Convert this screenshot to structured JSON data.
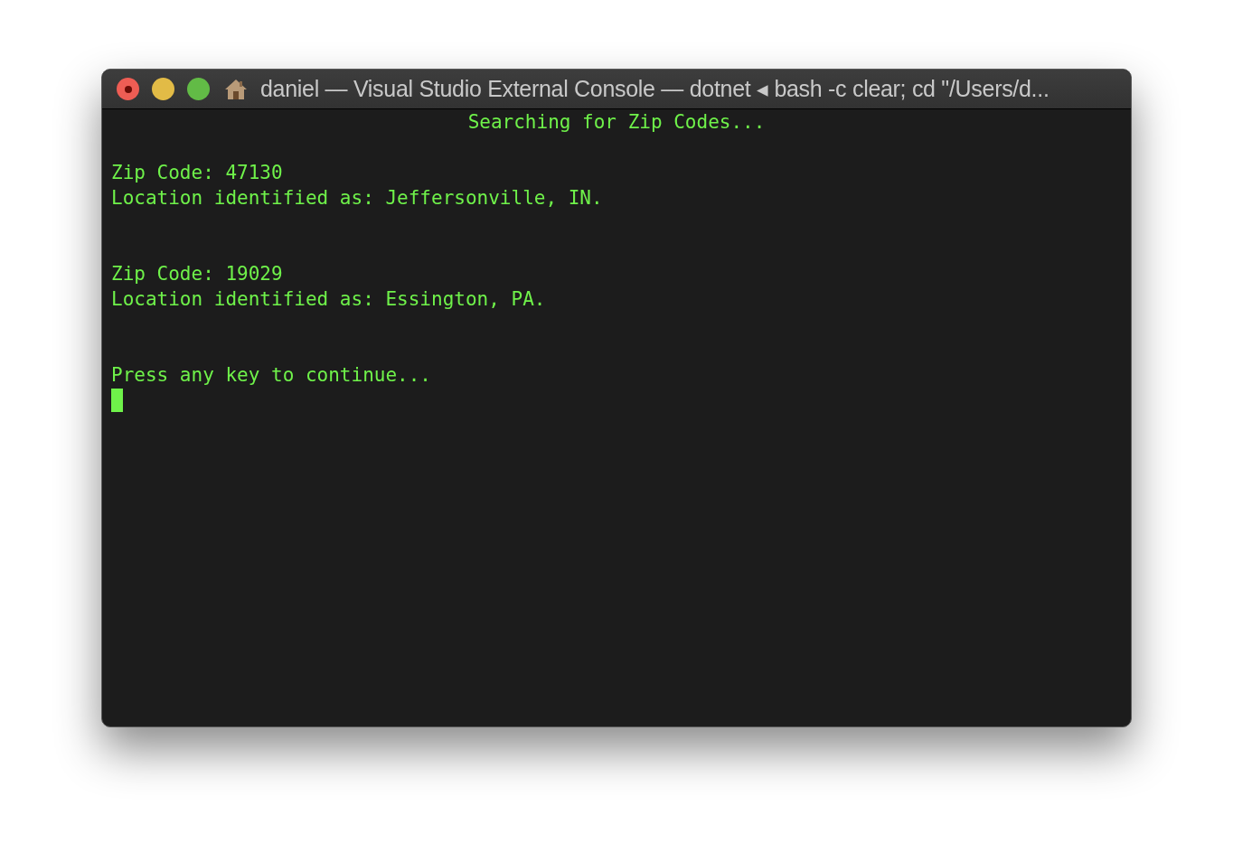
{
  "window": {
    "title": "daniel — Visual Studio External Console — dotnet ◂ bash -c clear; cd \"/Users/d..."
  },
  "console": {
    "heading": "Searching for Zip Codes...",
    "blocks": [
      [
        "Zip Code: 47130",
        "Location identified as: Jeffersonville, IN."
      ],
      [
        "Zip Code: 19029",
        "Location identified as: Essington, PA."
      ],
      [
        "Press any key to continue..."
      ]
    ],
    "cursor_visible": true
  }
}
